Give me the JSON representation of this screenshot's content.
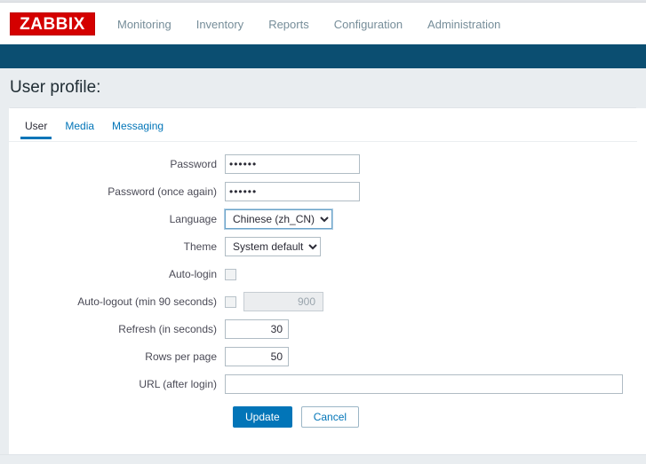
{
  "app": {
    "logo_text": "ZABBIX",
    "logo_color": "#d40000"
  },
  "nav": {
    "items": [
      {
        "label": "Monitoring"
      },
      {
        "label": "Inventory"
      },
      {
        "label": "Reports"
      },
      {
        "label": "Configuration"
      },
      {
        "label": "Administration"
      }
    ]
  },
  "header": {
    "title": "User profile:",
    "band_color": "#0b4e71"
  },
  "tabs": [
    {
      "label": "User",
      "active": true
    },
    {
      "label": "Media",
      "active": false
    },
    {
      "label": "Messaging",
      "active": false
    }
  ],
  "form": {
    "password": {
      "label": "Password",
      "value": "••••••"
    },
    "password_again": {
      "label": "Password (once again)",
      "value": "••••••"
    },
    "language": {
      "label": "Language",
      "value": "Chinese (zh_CN)",
      "options": [
        "Chinese (zh_CN)"
      ]
    },
    "theme": {
      "label": "Theme",
      "value": "System default",
      "options": [
        "System default"
      ]
    },
    "auto_login": {
      "label": "Auto-login",
      "checked": false
    },
    "auto_logout": {
      "label": "Auto-logout (min 90 seconds)",
      "checked": false,
      "value": "900",
      "disabled": true
    },
    "refresh": {
      "label": "Refresh (in seconds)",
      "value": "30"
    },
    "rows_per_page": {
      "label": "Rows per page",
      "value": "50"
    },
    "url_after_login": {
      "label": "URL (after login)",
      "value": "",
      "placeholder": ""
    },
    "buttons": {
      "update": "Update",
      "cancel": "Cancel"
    }
  },
  "colors": {
    "accent_blue": "#0275b8",
    "navy": "#0b4e71",
    "logo_red": "#d40000",
    "panel_bg": "#e9edf0"
  }
}
